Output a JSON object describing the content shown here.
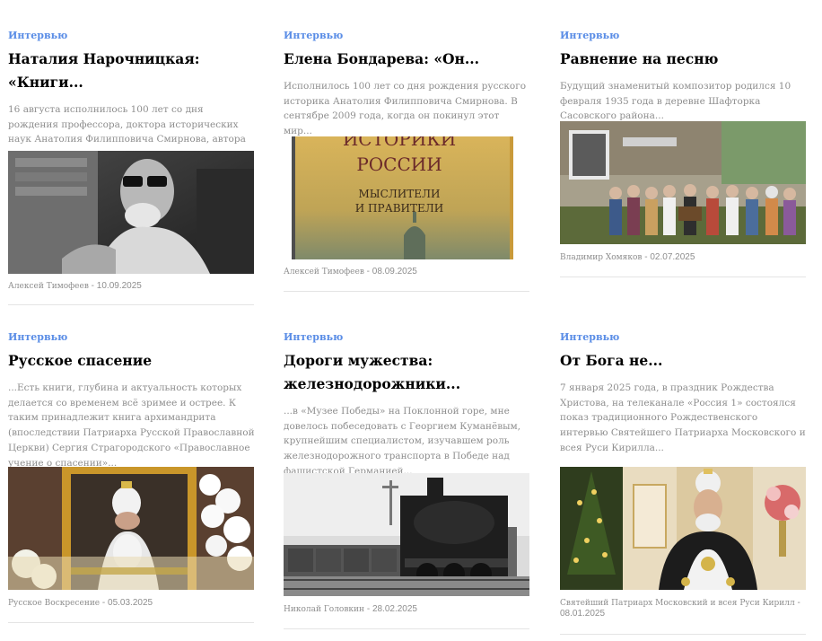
{
  "cards": [
    {
      "category": "Интервью",
      "title": "Наталия Нарочницкая: «Книги...",
      "excerpt": "16 августа исполнилось 100 лет со дня рождения профессора, доктора исторических наук Анатолия Филипповича Смирнова, автора многих книг по истории...",
      "image_desc": "portrait-old-scholar-bw",
      "author": "Алексей Тимофеев",
      "date": "10.09.2025"
    },
    {
      "category": "Интервью",
      "title": "Елена Бондарева: «Он...",
      "excerpt": "Исполнилось 100 лет со дня рождения русского историка Анатолия Филипповича Смирнова. В сентябре 2009 года, когда он покинул этот мир...",
      "image_desc": "book-cover",
      "book_line1": "ИСТОРИКИ",
      "book_line2": "РОССИИ",
      "book_line3": "МЫСЛИТЕЛИ",
      "book_line4": "И ПРАВИТЕЛИ",
      "author": "Алексей Тимофеев",
      "date": "08.09.2025"
    },
    {
      "category": "Интервью",
      "title": "Равнение на песню",
      "excerpt": "Будущий знаменитый композитор родился 10 февраля 1935 года в деревне Шафторка Сасовского района...",
      "image_desc": "village-group-photo",
      "author": "Владимир Хомяков",
      "date": "02.07.2025"
    },
    {
      "category": "Интервью",
      "title": "Русское спасение",
      "excerpt": "...Есть книги, глубина и актуальность которых делается со временем всё зримее и острее. К таким принадлежит книга архимандрита (впоследствии Патриарха Русской Православной Церкви) Сергия Страгородского «Православное учение о спасении»...",
      "image_desc": "patriarch-portrait-with-flowers",
      "author": "Русское Воскресение",
      "date": "05.03.2025"
    },
    {
      "category": "Интервью",
      "title": "Дороги мужества: железнодорожники...",
      "excerpt": "...в «Музее Победы» на Поклонной горе, мне довелось побеседовать с Георгием Куманёвым, крупнейшим специалистом, изучавшем роль железнодорожного транспорта в Победе над фашистской Германией...",
      "image_desc": "steam-locomotive-bw",
      "author": "Николай Головкин",
      "date": "28.02.2025"
    },
    {
      "category": "Интервью",
      "title": "От Бога не...",
      "excerpt": "7 января 2025 года, в праздник Рождества Христова, на телеканале «Россия 1» состоялся показ традиционного Рождественского интервью Святейшего Патриарха Московского и всея Руси Кирилла...",
      "image_desc": "patriarch-kirill-interview",
      "author": "Святейший Патриарх Московский и всея Руси Кирилл",
      "date": "08.01.2025"
    }
  ],
  "meta_separator": " - "
}
